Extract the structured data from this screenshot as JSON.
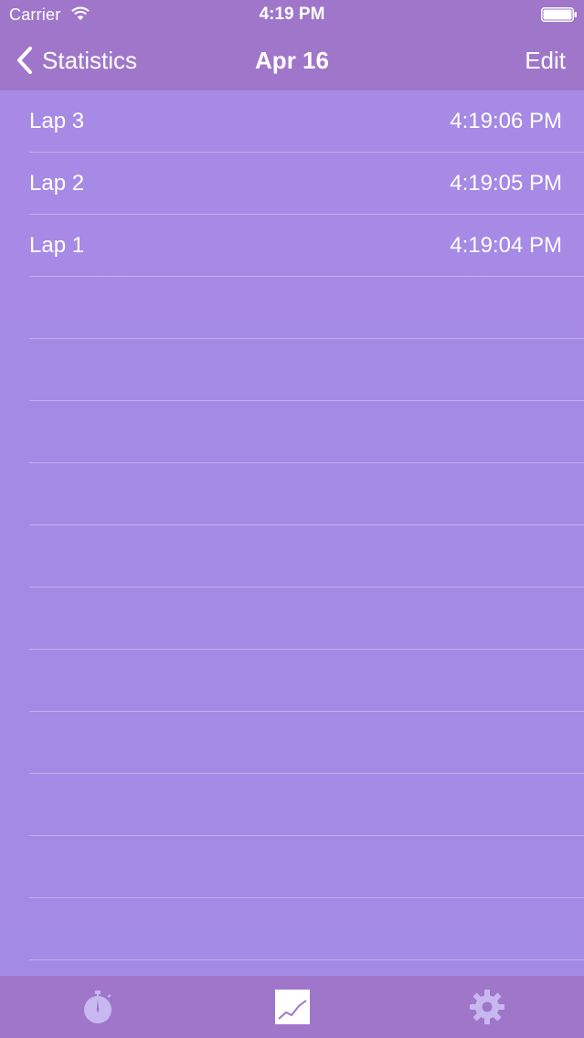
{
  "status_bar": {
    "carrier": "Carrier",
    "time": "4:19 PM"
  },
  "nav": {
    "back_label": "Statistics",
    "title": "Apr 16",
    "edit_label": "Edit"
  },
  "laps": [
    {
      "name": "Lap 3",
      "time": "4:19:06 PM"
    },
    {
      "name": "Lap 2",
      "time": "4:19:05 PM"
    },
    {
      "name": "Lap 1",
      "time": "4:19:04 PM"
    }
  ],
  "empty_rows": 11,
  "tabs": [
    {
      "icon": "stopwatch-icon",
      "selected": false
    },
    {
      "icon": "chart-icon",
      "selected": true
    },
    {
      "icon": "gear-icon",
      "selected": false
    }
  ],
  "colors": {
    "bars": "#a076cb",
    "background": "#a58ae5",
    "text": "#ffffff",
    "inactive_tab": "#c7b9ef"
  }
}
